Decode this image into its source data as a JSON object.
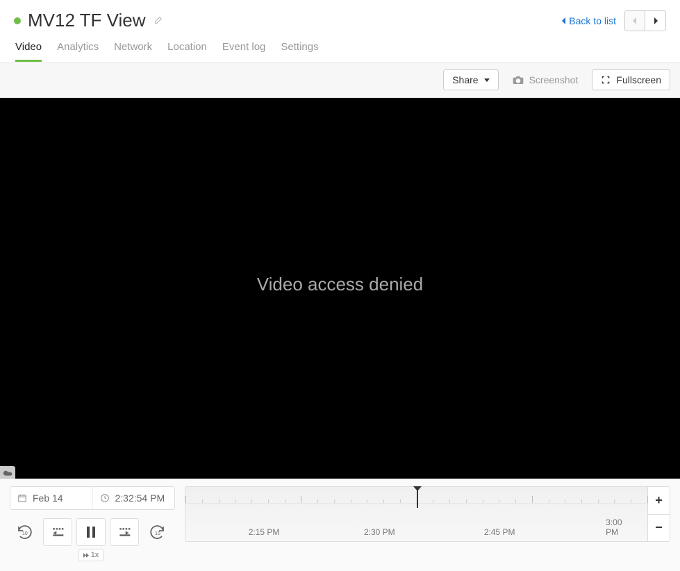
{
  "header": {
    "title": "MV12 TF View",
    "back_label": "Back to list"
  },
  "tabs": [
    "Video",
    "Analytics",
    "Network",
    "Location",
    "Event log",
    "Settings"
  ],
  "active_tab": "Video",
  "toolbar": {
    "share_label": "Share",
    "screenshot_label": "Screenshot",
    "fullscreen_label": "Fullscreen"
  },
  "video": {
    "message": "Video access denied"
  },
  "controls": {
    "date": "Feb 14",
    "time": "2:32:54 PM",
    "speed": "1x"
  },
  "timeline": {
    "labels": [
      "2:15 PM",
      "2:30 PM",
      "2:45 PM",
      "3:00 PM"
    ],
    "label_positions_pct": [
      17,
      42,
      68,
      94
    ],
    "playhead_pct": 50
  }
}
